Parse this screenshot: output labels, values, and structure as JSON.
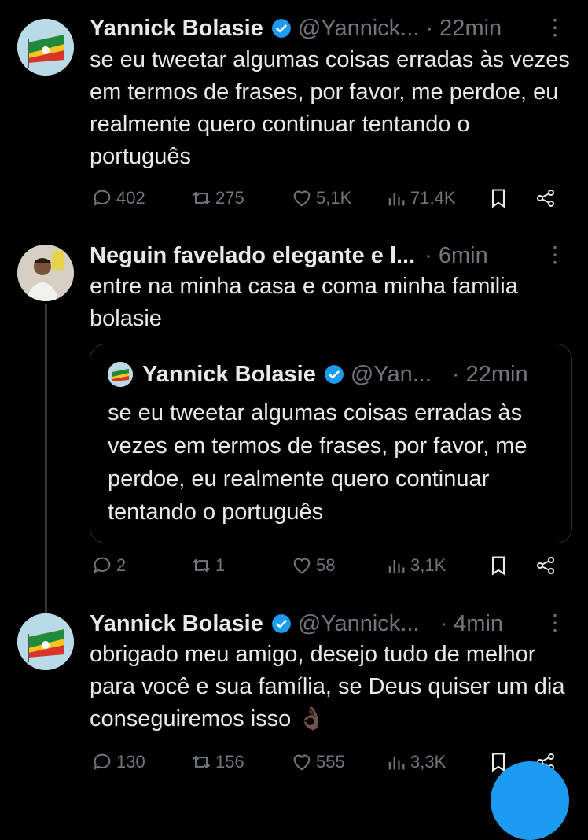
{
  "colors": {
    "accent": "#1d9bf0",
    "muted": "#71767b",
    "text": "#e7e9ea",
    "background": "#000000"
  },
  "tweets": [
    {
      "name": "Yannick Bolasie",
      "handle": "@Yannick...",
      "time": "· 22min",
      "text": "se eu tweetar algumas coisas erradas às vezes em termos de frases, por favor, me perdoe, eu realmente quero continuar tentando o português",
      "replies": "402",
      "retweets": "275",
      "likes": "5,1K",
      "views": "71,4K"
    },
    {
      "name": "Neguin favelado elegante e l...",
      "time": "· 6min",
      "text": "entre na minha casa e coma minha familia bolasie",
      "quote": {
        "name": "Yannick Bolasie",
        "handle": "@Yan...",
        "time": "· 22min",
        "text": "se eu tweetar algumas coisas erradas às vezes em termos de frases, por favor, me perdoe, eu realmente quero continuar tentando o português"
      },
      "replies": "2",
      "retweets": "1",
      "likes": "58",
      "views": "3,1K"
    },
    {
      "name": "Yannick Bolasie",
      "handle": "@Yannick...",
      "time": "· 4min",
      "text": "obrigado meu amigo, desejo tudo de melhor para você e sua família, se Deus quiser um dia conseguiremos isso 👌🏿",
      "replies": "130",
      "retweets": "156",
      "likes": "555",
      "views": "3,3K"
    }
  ]
}
